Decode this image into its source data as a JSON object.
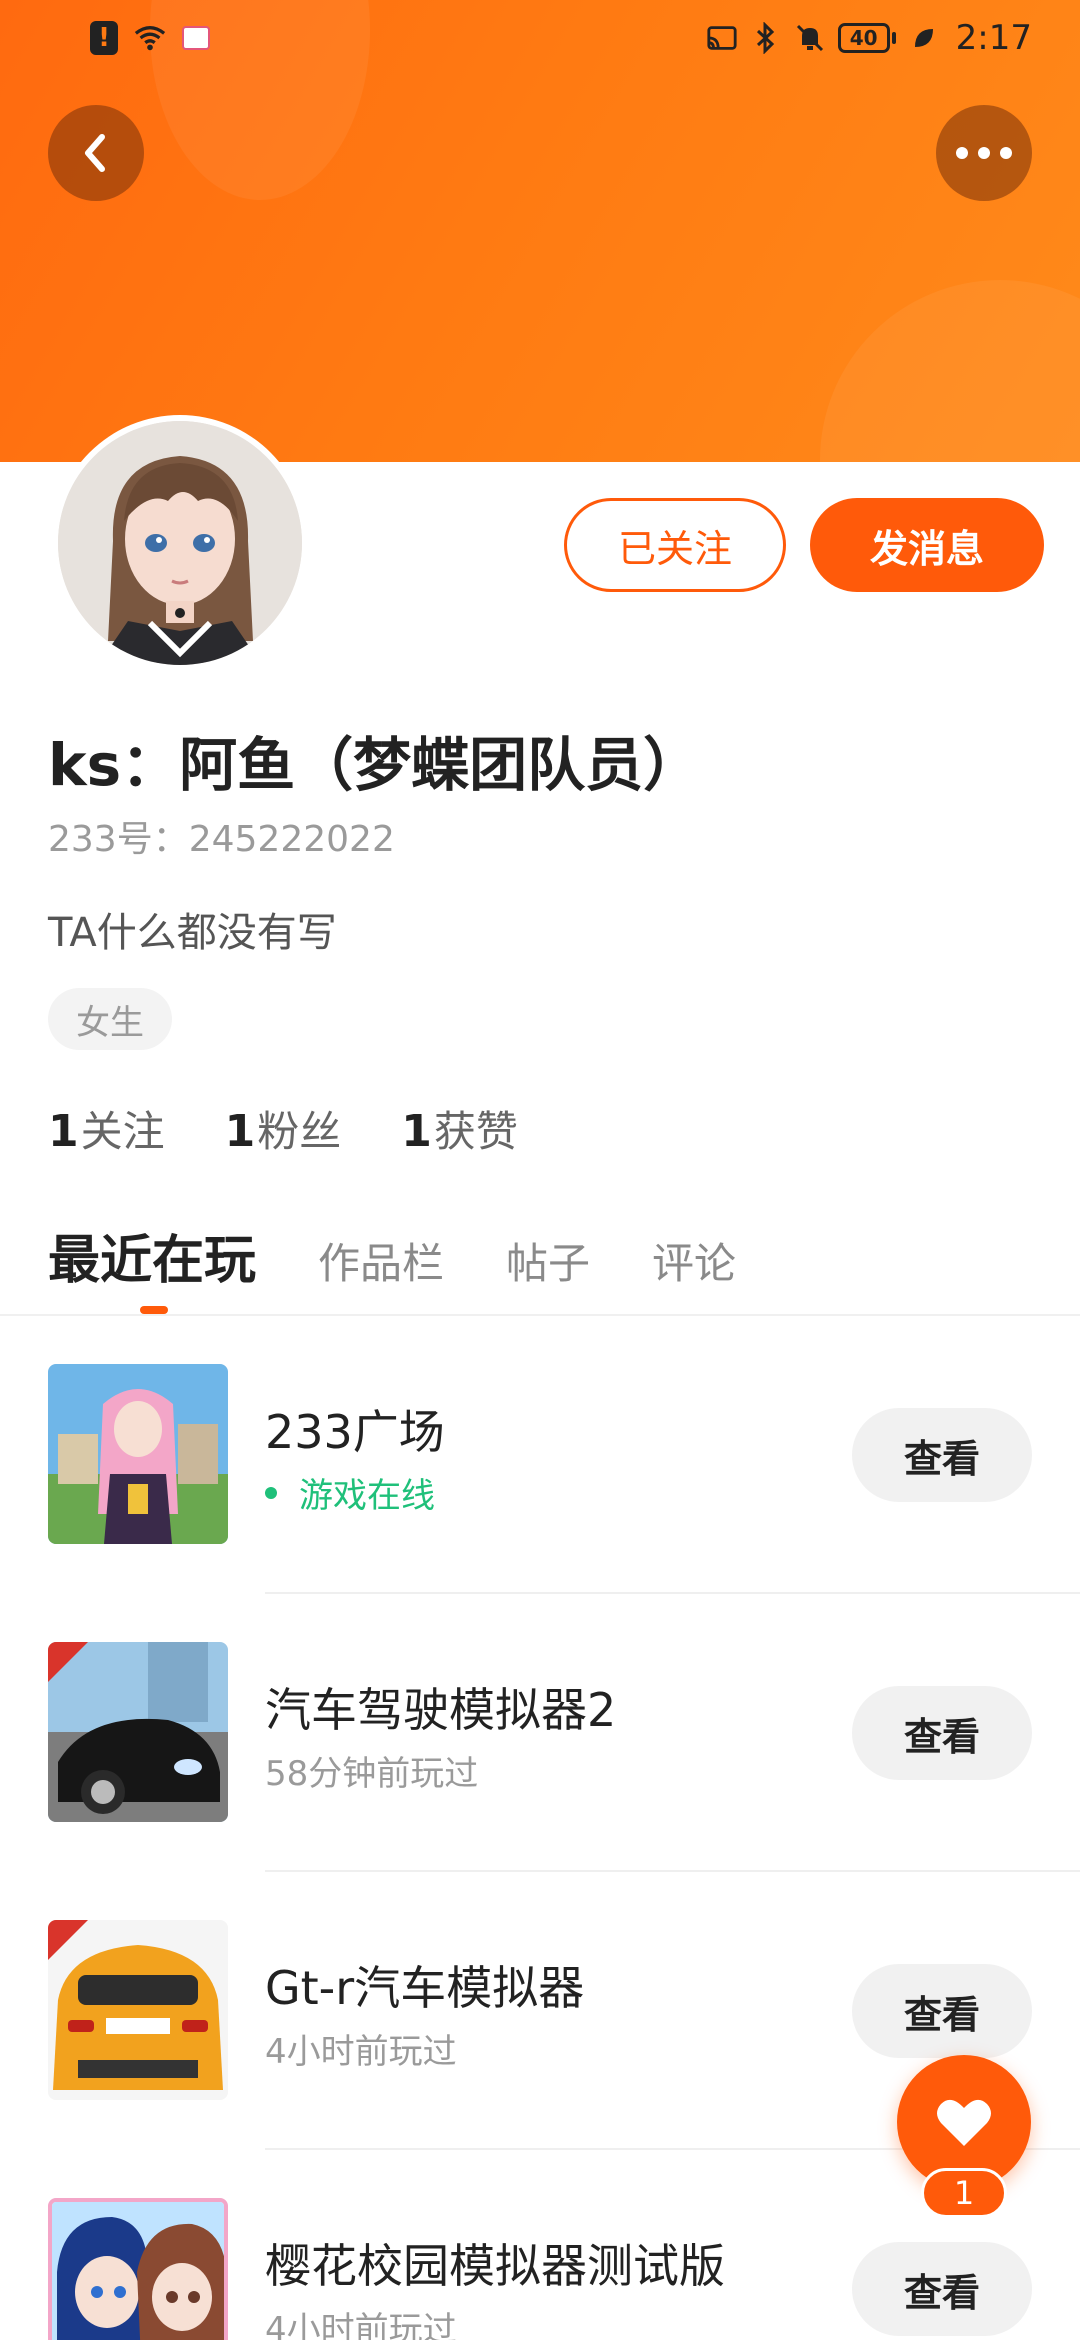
{
  "status_bar": {
    "time": "2:17",
    "battery_level": "40",
    "left_icons": [
      "alert-icon",
      "wifi-icon",
      "book-icon"
    ],
    "right_icons": [
      "cast-icon",
      "bluetooth-icon",
      "mute-bell-icon",
      "battery-icon",
      "leaf-icon"
    ]
  },
  "colors": {
    "accent": "#ff5a0a",
    "banner": "#ff7a12",
    "online": "#1fc07a"
  },
  "profile": {
    "nickname": "ks：阿鱼（梦蝶团队员）",
    "id_label": "233号：",
    "id_value": "245222022",
    "bio": "TA什么都没有写",
    "gender_tag": "女生",
    "follow_button": "已关注",
    "message_button": "发消息"
  },
  "stats": [
    {
      "count": "1",
      "label": "关注"
    },
    {
      "count": "1",
      "label": "粉丝"
    },
    {
      "count": "1",
      "label": "获赞"
    }
  ],
  "tabs": [
    {
      "label": "最近在玩",
      "active": true
    },
    {
      "label": "作品栏",
      "active": false
    },
    {
      "label": "帖子",
      "active": false
    },
    {
      "label": "评论",
      "active": false
    }
  ],
  "games": [
    {
      "name": "233广场",
      "status": "游戏在线",
      "online": true,
      "button": "查看"
    },
    {
      "name": "汽车驾驶模拟器2",
      "status": "58分钟前玩过",
      "online": false,
      "button": "查看"
    },
    {
      "name": "Gt-r汽车模拟器",
      "status": "4小时前玩过",
      "online": false,
      "button": "查看"
    },
    {
      "name": "樱花校园模拟器测试版",
      "status": "4小时前玩过",
      "online": false,
      "button": "查看"
    }
  ],
  "like_fab": {
    "count": "1"
  }
}
